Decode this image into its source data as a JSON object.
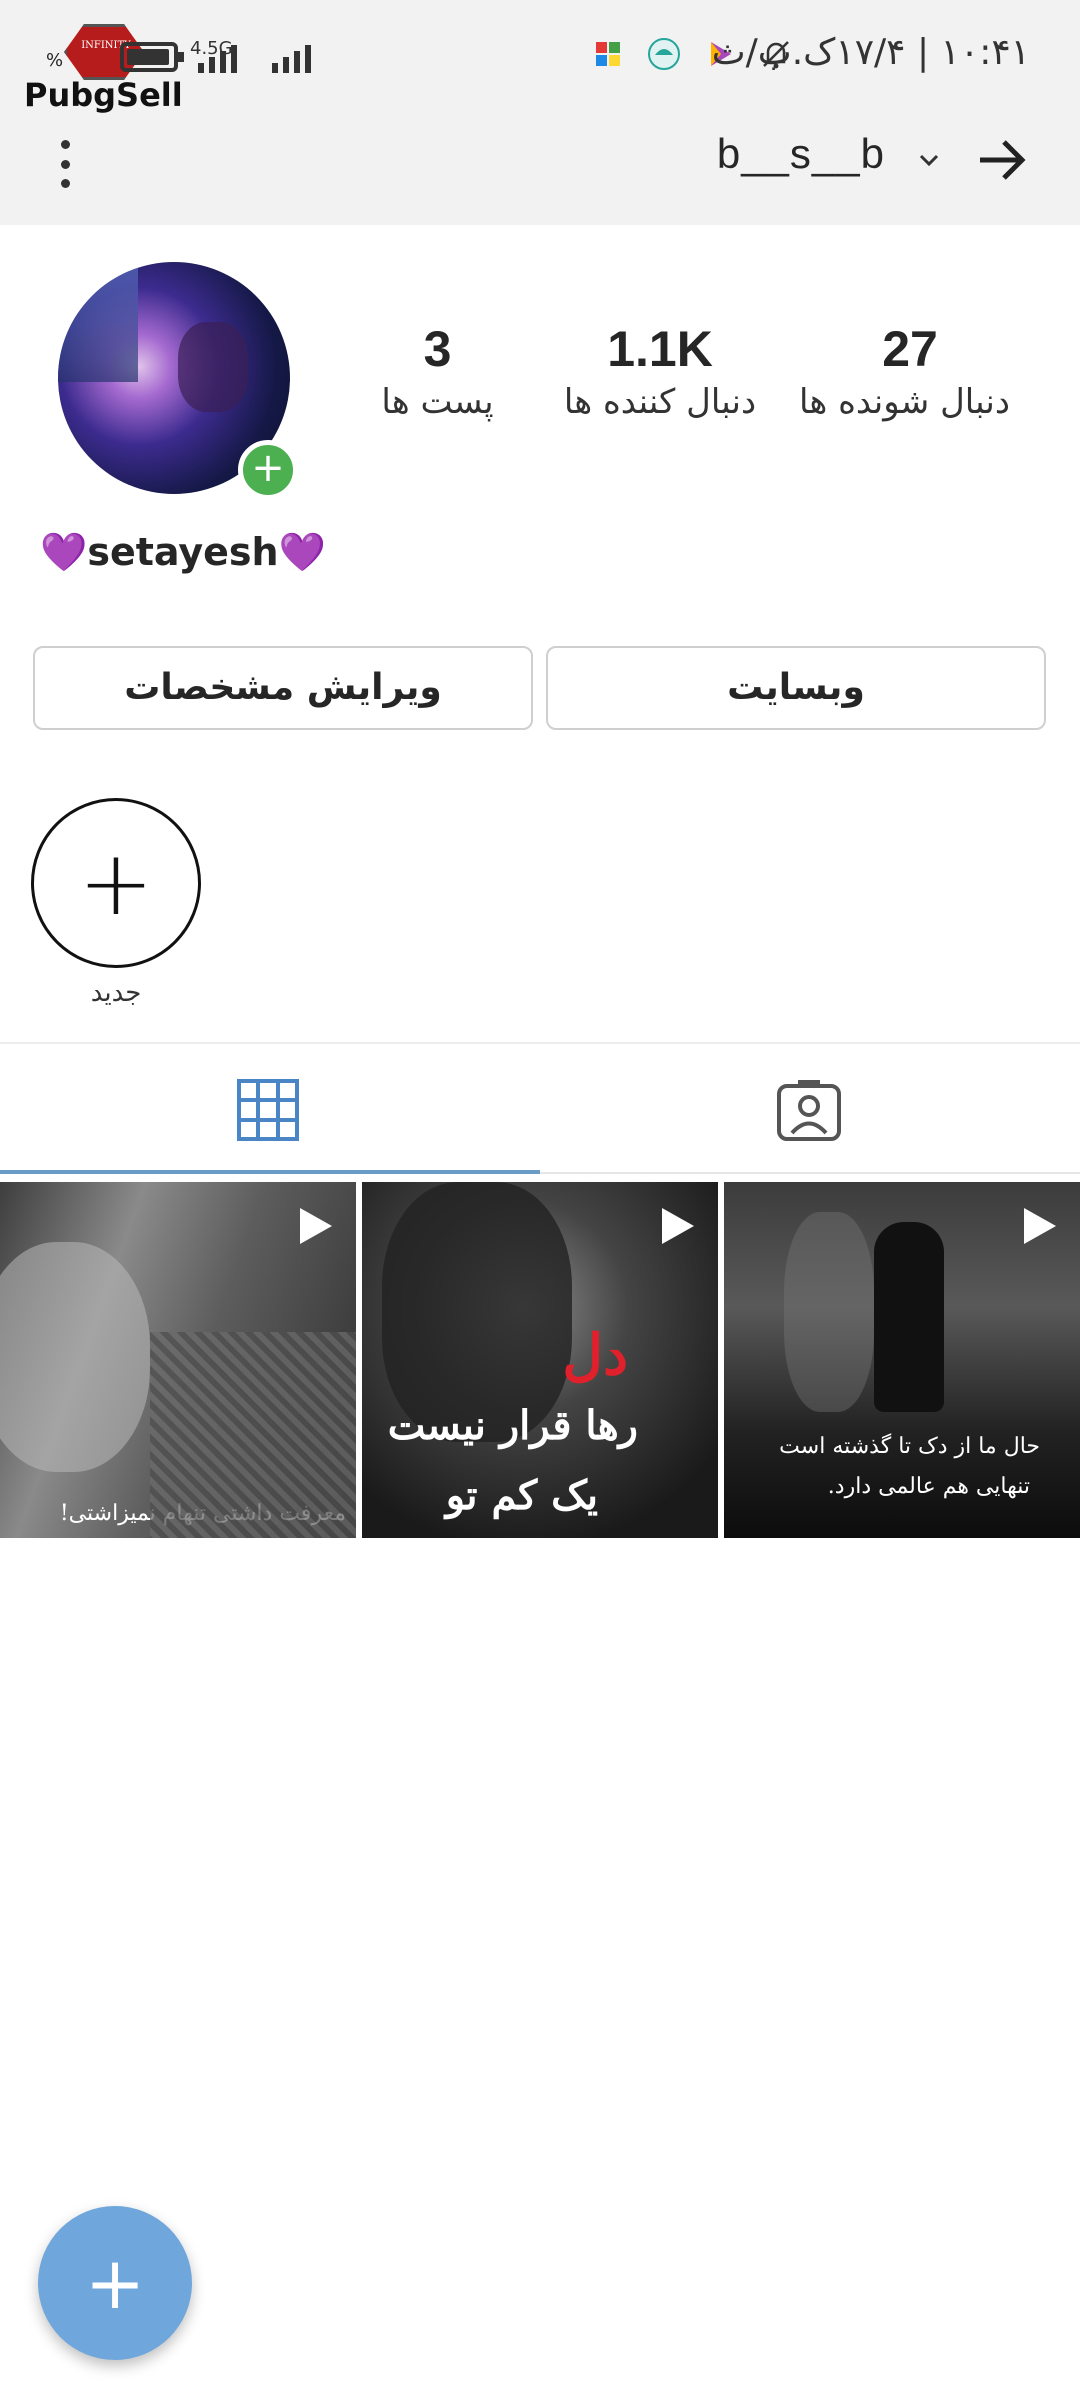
{
  "status_bar": {
    "time": "۱۰:۴۱ | ۱۷/۴ک.ب/ث",
    "network": "4.5G",
    "battery_percent_symbol": "%",
    "logo_text": "PubgSell",
    "logo_badge_text": "INFINITY",
    "icons": [
      "mute-bell-icon",
      "play-store-icon",
      "weather-app-icon",
      "game-app-icon"
    ]
  },
  "app_bar": {
    "username": "b__s__b",
    "back_icon": "arrow-right-icon",
    "dropdown_icon": "chevron-down-icon",
    "menu_icon": "more-vertical-icon"
  },
  "profile": {
    "display_name": "setayesh",
    "name_emoji": "💜",
    "stats": {
      "following": {
        "value": "27",
        "label": "دنبال شونده ها"
      },
      "followers": {
        "value": "1.1K",
        "label": "دنبال کننده ها"
      },
      "posts": {
        "value": "3",
        "label": "پست ها"
      }
    },
    "buttons": {
      "edit_profile": "ویرایش مشخصات",
      "website": "وبسایت"
    },
    "highlight_new_label": "جدید"
  },
  "tabs": [
    {
      "icon": "grid-icon",
      "active": true
    },
    {
      "icon": "tagged-person-icon",
      "active": false
    }
  ],
  "posts": [
    {
      "type": "video",
      "caption": "معرفت داشتی تنهام نمیزاشتی!"
    },
    {
      "type": "video",
      "caption_lines": [
        "دل",
        "رها قرار نیست",
        "یک کم تو"
      ]
    },
    {
      "type": "video",
      "caption_lines": [
        "حال ما از دک تا گذشته است",
        "تنهایی هم عالمی دارد."
      ]
    }
  ],
  "fab": {
    "icon": "plus-icon"
  },
  "colors": {
    "accent_blue": "#6b9bc7",
    "fab_blue": "#6fa6dc",
    "add_green": "#4caf50",
    "heart_purple": "#9c3ccc"
  }
}
